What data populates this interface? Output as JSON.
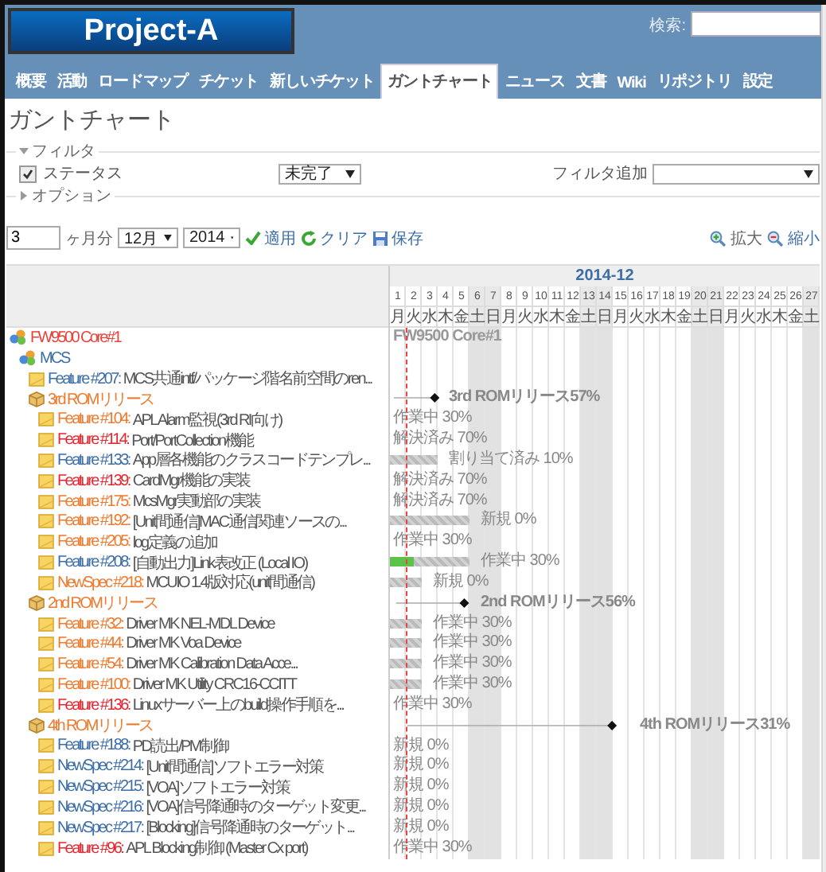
{
  "header": {
    "logo": "Project-A",
    "search_label": "検索:"
  },
  "tabs": [
    {
      "label": "概要",
      "selected": false
    },
    {
      "label": "活動",
      "selected": false
    },
    {
      "label": "ロードマップ",
      "selected": false
    },
    {
      "label": "チケット",
      "selected": false
    },
    {
      "label": "新しいチケット",
      "selected": false
    },
    {
      "label": "ガントチャート",
      "selected": true
    },
    {
      "label": "ニュース",
      "selected": false
    },
    {
      "label": "文書",
      "selected": false
    },
    {
      "label": "Wiki",
      "selected": false
    },
    {
      "label": "リポジトリ",
      "selected": false
    },
    {
      "label": "設定",
      "selected": false
    }
  ],
  "page_title": "ガントチャート",
  "filters": {
    "legend": "フィルタ",
    "expanded": true,
    "status": {
      "label": "ステータス",
      "checked": true,
      "value": "未完了"
    },
    "add_label": "フィルタ追加"
  },
  "options": {
    "legend": "オプション",
    "expanded": false
  },
  "controls": {
    "months": "3",
    "months_label": "ヶ月分",
    "month": "12月",
    "year": "2014",
    "apply": "適用",
    "clear": "クリア",
    "save": "保存",
    "zoom_in": "拡大",
    "zoom_out": "縮小"
  },
  "gantt": {
    "month": "2014-12",
    "days": [
      {
        "day": "1",
        "weekday": "月",
        "weekend": false
      },
      {
        "day": "2",
        "weekday": "火",
        "weekend": false
      },
      {
        "day": "3",
        "weekday": "水",
        "weekend": false
      },
      {
        "day": "4",
        "weekday": "木",
        "weekend": false
      },
      {
        "day": "5",
        "weekday": "金",
        "weekend": false
      },
      {
        "day": "6",
        "weekday": "土",
        "weekend": true
      },
      {
        "day": "7",
        "weekday": "日",
        "weekend": true
      },
      {
        "day": "8",
        "weekday": "月",
        "weekend": false
      },
      {
        "day": "9",
        "weekday": "火",
        "weekend": false
      },
      {
        "day": "10",
        "weekday": "水",
        "weekend": false
      },
      {
        "day": "11",
        "weekday": "木",
        "weekend": false
      },
      {
        "day": "12",
        "weekday": "金",
        "weekend": false
      },
      {
        "day": "13",
        "weekday": "土",
        "weekend": true
      },
      {
        "day": "14",
        "weekday": "日",
        "weekend": true
      },
      {
        "day": "15",
        "weekday": "月",
        "weekend": false
      },
      {
        "day": "16",
        "weekday": "火",
        "weekend": false
      },
      {
        "day": "17",
        "weekday": "水",
        "weekend": false
      },
      {
        "day": "18",
        "weekday": "木",
        "weekend": false
      },
      {
        "day": "19",
        "weekday": "金",
        "weekend": false
      },
      {
        "day": "20",
        "weekday": "土",
        "weekend": true
      },
      {
        "day": "21",
        "weekday": "日",
        "weekend": true
      },
      {
        "day": "22",
        "weekday": "月",
        "weekend": false
      },
      {
        "day": "23",
        "weekday": "火",
        "weekend": false
      },
      {
        "day": "24",
        "weekday": "水",
        "weekend": false
      },
      {
        "day": "25",
        "weekday": "木",
        "weekend": false
      },
      {
        "day": "26",
        "weekday": "金",
        "weekend": false
      },
      {
        "day": "27",
        "weekday": "土",
        "weekend": true
      }
    ],
    "tree": [
      {
        "kind": "project",
        "name": "FW9500 Core#1",
        "color": "#e8423a",
        "chart_label": "FW9500 Core#1",
        "children": [
          {
            "kind": "project",
            "name": "MCS",
            "color": "#3d6ea8",
            "children": [
              {
                "kind": "issue",
                "tracker": "Feature #207:",
                "subject": "MCS共通intf/パッケージ階名前空間のren...",
                "color": "#3d6ea8",
                "has_bar": false
              },
              {
                "kind": "version",
                "name": "3rd ROMリリース",
                "color": "#ee7a2d",
                "milestone": {
                  "label": "3rd ROMリリース57%"
                },
                "children": [
                  {
                    "kind": "issue",
                    "tracker": "Feature #104:",
                    "subject": "APL Alarm監視(3rd RI向け)",
                    "color": "#ee7a2d",
                    "has_bar": false,
                    "label": "作業中 30%"
                  },
                  {
                    "kind": "issue",
                    "tracker": "Feature #114:",
                    "subject": "Port/PortCollection機能",
                    "color": "#e8262f",
                    "has_bar": false,
                    "label": "解決済み 70%"
                  },
                  {
                    "kind": "issue",
                    "tracker": "Feature #133:",
                    "subject": "App層各機能のクラスコードテンプレ...",
                    "color": "#3d6ea8",
                    "has_bar": true,
                    "label": "割り当て済み 10%"
                  },
                  {
                    "kind": "issue",
                    "tracker": "Feature #139:",
                    "subject": "CardMgr機能の実装",
                    "color": "#e8262f",
                    "has_bar": false,
                    "label": "解決済み 70%"
                  },
                  {
                    "kind": "issue",
                    "tracker": "Feature #175:",
                    "subject": "McsMgr実動部の実装",
                    "color": "#ee7a2d",
                    "has_bar": false,
                    "label": "解決済み 70%"
                  },
                  {
                    "kind": "issue",
                    "tracker": "Feature #192:",
                    "subject": "[Unit間通信]MAC通信関連ソースの...",
                    "color": "#ee7a2d",
                    "has_bar": true,
                    "label": "新規 0%"
                  },
                  {
                    "kind": "issue",
                    "tracker": "Feature #205:",
                    "subject": "log定義の追加",
                    "color": "#ee7a2d",
                    "has_bar": false,
                    "label": "作業中 30%"
                  },
                  {
                    "kind": "issue",
                    "tracker": "Feature #208:",
                    "subject": "[自動出力]Link表改正 (Local IO)",
                    "color": "#3d6ea8",
                    "has_bar": true,
                    "progress": {
                      "level": 0.3
                    },
                    "label": "作業中 30%"
                  },
                  {
                    "kind": "issue",
                    "tracker": "NewSpec #218:",
                    "subject": "MCUIO 1.4版対応(unit間通信)",
                    "color": "#ee7a2d",
                    "has_bar": true,
                    "label": "新規 0%"
                  }
                ]
              },
              {
                "kind": "version",
                "name": "2nd ROMリリース",
                "color": "#ee7a2d",
                "milestone": {
                  "label": "2nd ROMリリース56%"
                },
                "children": [
                  {
                    "kind": "issue",
                    "tracker": "Feature #32:",
                    "subject": "Driver MK NEL-MDL Device",
                    "color": "#ee7a2d",
                    "has_bar": true,
                    "label": "作業中 30%"
                  },
                  {
                    "kind": "issue",
                    "tracker": "Feature #44:",
                    "subject": "Driver MK Voa Device",
                    "color": "#ee7a2d",
                    "has_bar": true,
                    "label": "作業中 30%"
                  },
                  {
                    "kind": "issue",
                    "tracker": "Feature #54:",
                    "subject": "Driver MK Calibration Data Acce...",
                    "color": "#ee7a2d",
                    "has_bar": true,
                    "label": "作業中 30%"
                  },
                  {
                    "kind": "issue",
                    "tracker": "Feature #100:",
                    "subject": "Driver MK Utility CRC16-CCITT",
                    "color": "#ee7a2d",
                    "has_bar": true,
                    "label": "作業中 30%"
                  },
                  {
                    "kind": "issue",
                    "tracker": "Feature #136:",
                    "subject": "Linuxサーバー上のbuild操作手順を...",
                    "color": "#e8262f",
                    "has_bar": false,
                    "label": "作業中 30%"
                  }
                ]
              },
              {
                "kind": "version",
                "name": "4th ROMリリース",
                "color": "#ee7a2d",
                "milestone": {
                  "label": "4th ROMリリース31%"
                },
                "children": [
                  {
                    "kind": "issue",
                    "tracker": "Feature #188:",
                    "subject": "PD読出/PM制御",
                    "color": "#3d6ea8",
                    "has_bar": false,
                    "label": "新規 0%"
                  },
                  {
                    "kind": "issue",
                    "tracker": "NewSpec #214:",
                    "subject": "[Unit間通信]ソフトエラー対策",
                    "color": "#3d6ea8",
                    "has_bar": false,
                    "label": "新規 0%"
                  },
                  {
                    "kind": "issue",
                    "tracker": "NewSpec #215:",
                    "subject": "[VOA]ソフトエラー対策",
                    "color": "#3d6ea8",
                    "has_bar": false,
                    "label": "新規 0%"
                  },
                  {
                    "kind": "issue",
                    "tracker": "NewSpec #216:",
                    "subject": "[VOA]信号降通時のターゲット変更...",
                    "color": "#3d6ea8",
                    "has_bar": false,
                    "label": "新規 0%"
                  },
                  {
                    "kind": "issue",
                    "tracker": "NewSpec #217:",
                    "subject": "[Blocking]信号降通時のターゲット...",
                    "color": "#3d6ea8",
                    "has_bar": false,
                    "label": "新規 0%"
                  },
                  {
                    "kind": "issue",
                    "tracker": "Feature #96:",
                    "subject": "APL Blocking制御 (Master Cx port)",
                    "color": "#e8262f",
                    "has_bar": false,
                    "label": "作業中 30%"
                  }
                ]
              }
            ]
          }
        ]
      }
    ]
  }
}
